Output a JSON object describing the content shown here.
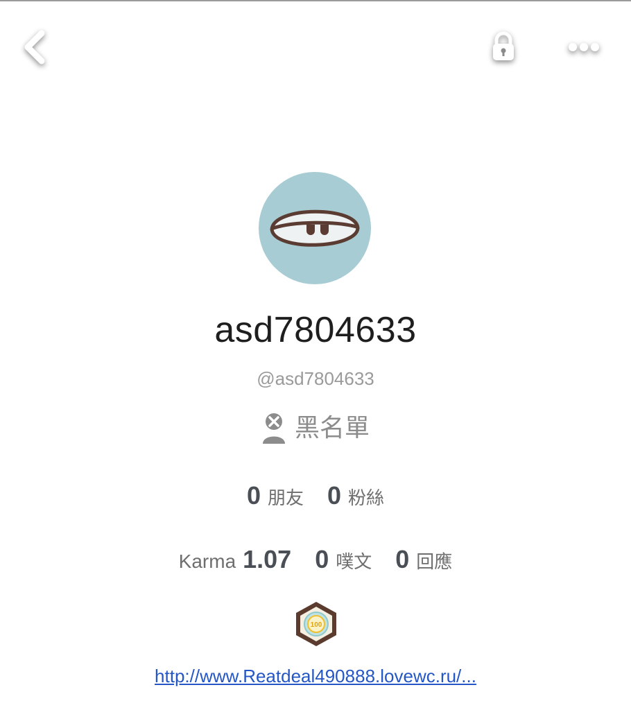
{
  "nav": {
    "back_icon": "chevron-left-icon",
    "lock_icon": "lock-icon",
    "more_icon": "more-dots-icon"
  },
  "profile": {
    "avatar_icon": "sleepy-eye-avatar",
    "avatar_bg": "#a8ccd3",
    "display_name": "asd7804633",
    "handle": "@asd7804633"
  },
  "blacklist": {
    "icon": "user-blocked-icon",
    "label": "黑名單"
  },
  "stats": {
    "friends_value": "0",
    "friends_label": "朋友",
    "fans_value": "0",
    "fans_label": "粉絲",
    "karma_label": "Karma",
    "karma_value": "1.07",
    "posts_value": "0",
    "posts_label": "噗文",
    "replies_value": "0",
    "replies_label": "回應"
  },
  "badge": {
    "icon": "hexagon-badge-icon",
    "text": "100"
  },
  "link": {
    "text": "http://www.Reatdeal490888.lovewc.ru/..."
  },
  "colors": {
    "accent_link": "#2457c5",
    "stat_value": "#4a4f55"
  }
}
